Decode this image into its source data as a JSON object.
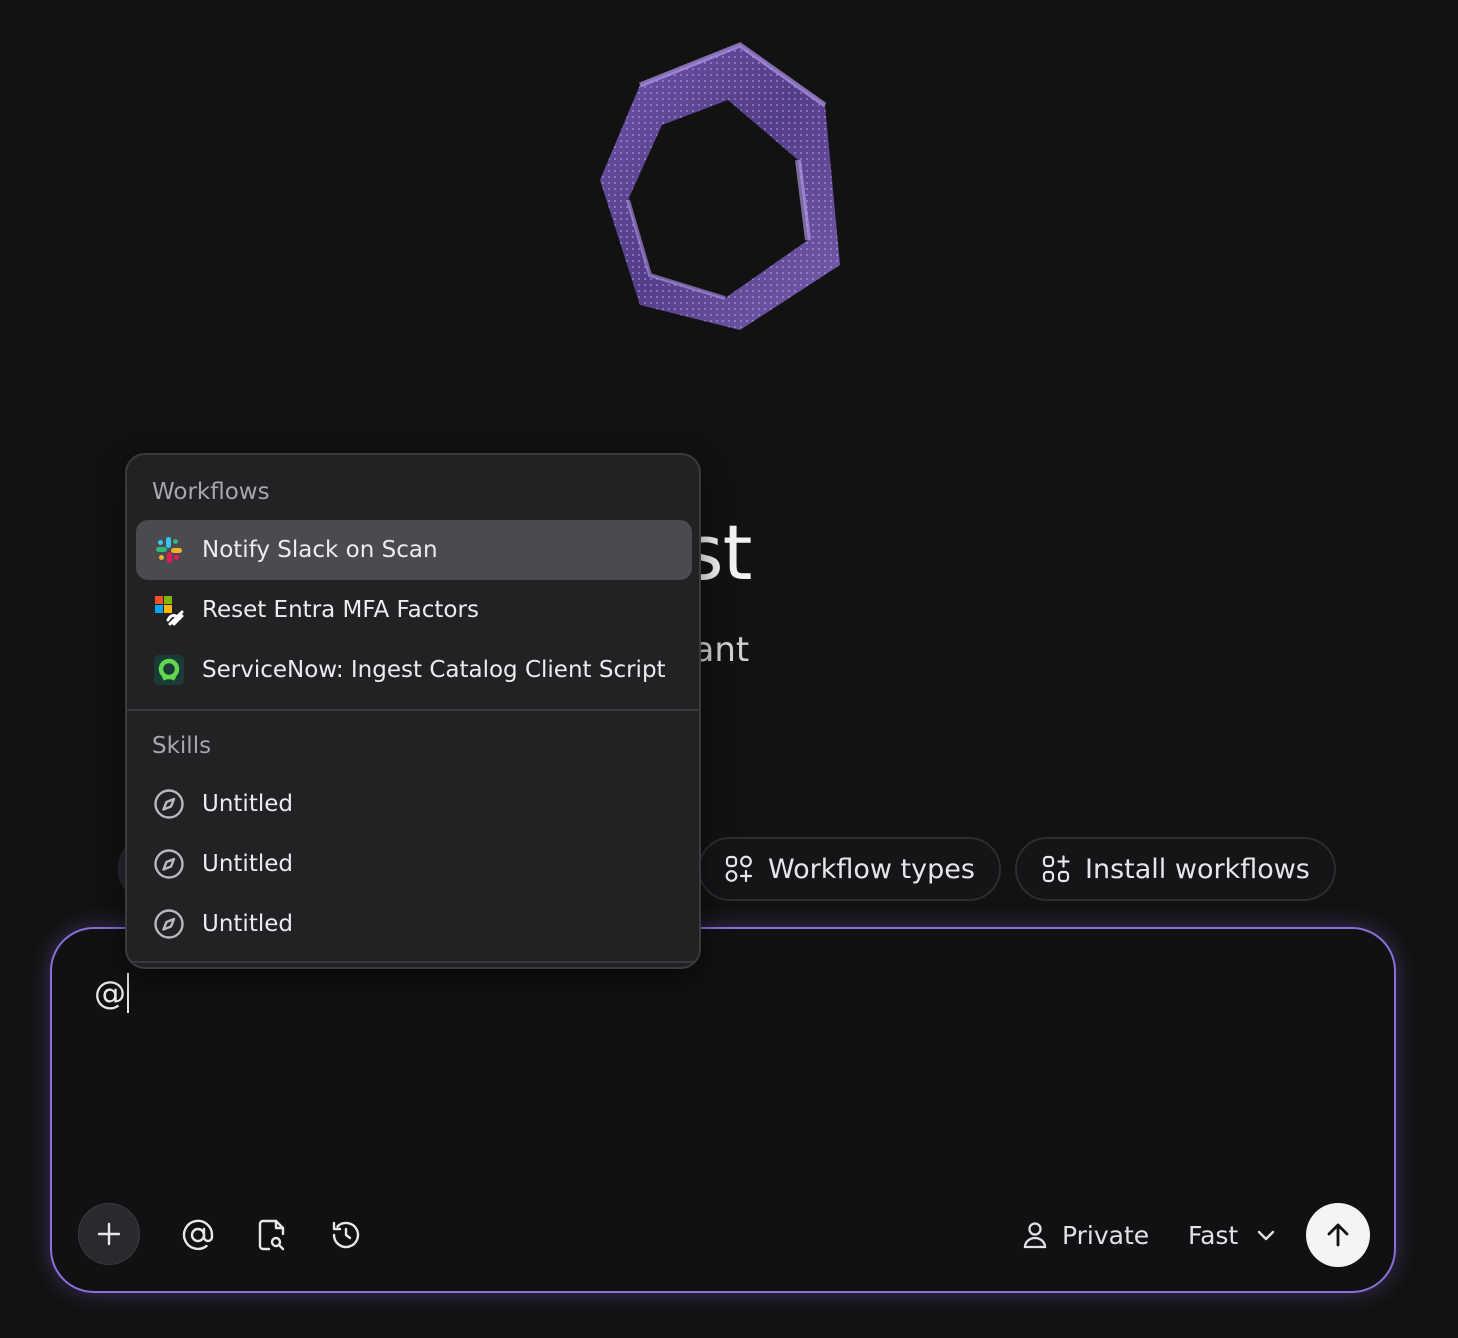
{
  "hero": {
    "title_visible": "atalyst",
    "subtitle_visible": "ation assistant"
  },
  "chips": [
    {
      "label": "Workflow types",
      "icon": "workflow-types-icon"
    },
    {
      "label": "Install workflows",
      "icon": "install-workflows-icon"
    }
  ],
  "composer": {
    "value": "@",
    "private_label": "Private",
    "model_label": "Fast"
  },
  "menu": {
    "workflows_label": "Workflows",
    "workflows": [
      {
        "label": "Notify Slack on Scan",
        "icon": "slack-icon",
        "active": true
      },
      {
        "label": "Reset Entra MFA Factors",
        "icon": "microsoft-entra-icon",
        "active": false
      },
      {
        "label": "ServiceNow: Ingest Catalog Client Script",
        "icon": "servicenow-icon",
        "active": false
      }
    ],
    "skills_label": "Skills",
    "skills": [
      {
        "label": "Untitled",
        "icon": "compass-icon"
      },
      {
        "label": "Untitled",
        "icon": "compass-icon"
      },
      {
        "label": "Untitled",
        "icon": "compass-icon"
      }
    ]
  },
  "colors": {
    "background": "#121212",
    "accent": "#8a6fd6",
    "menu_bg": "#222225",
    "active_item": "#4a4a4f"
  }
}
